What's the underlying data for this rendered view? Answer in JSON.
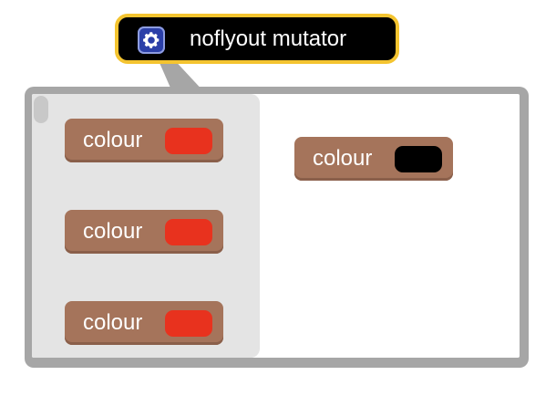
{
  "mutator": {
    "title": "noflyout mutator",
    "icon": "gear-icon",
    "colors": {
      "block": "#000000",
      "border": "#f4c430",
      "icon_bg": "#2b3fa8"
    }
  },
  "flyout": {
    "blocks": [
      {
        "label": "colour",
        "swatch_color": "#e8321e"
      },
      {
        "label": "colour",
        "swatch_color": "#e8321e"
      },
      {
        "label": "colour",
        "swatch_color": "#e8321e"
      }
    ]
  },
  "workspace": {
    "blocks": [
      {
        "label": "colour",
        "swatch_color": "#000000"
      }
    ]
  },
  "colors": {
    "block_fill": "#a5745b",
    "bubble_border": "#a6a6a6",
    "flyout_bg": "#e4e4e4"
  }
}
